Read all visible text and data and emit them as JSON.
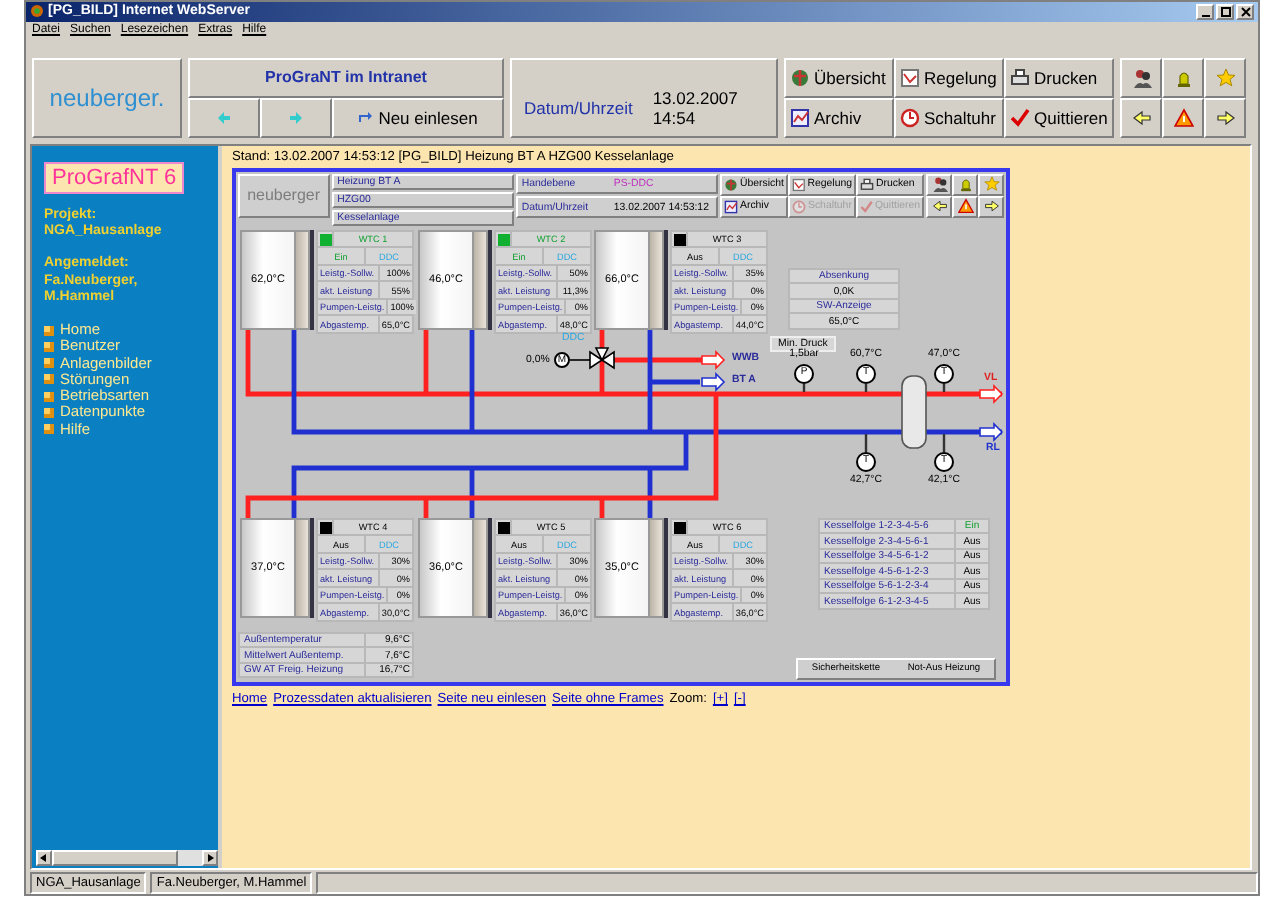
{
  "window": {
    "title": "[PG_BILD] Internet WebServer"
  },
  "menu": [
    "Datei",
    "Suchen",
    "Lesezeichen",
    "Extras",
    "Hilfe"
  ],
  "toolbar": {
    "logo": "neuberger.",
    "app_title": "ProGraNT im Intranet",
    "reload": "Neu einlesen",
    "datetime_label": "Datum/Uhrzeit",
    "datetime": "13.02.2007 14:54",
    "buttons": [
      {
        "label": "Übersicht",
        "kind": "overview"
      },
      {
        "label": "Regelung",
        "kind": "control"
      },
      {
        "label": "Drucken",
        "kind": "print"
      },
      {
        "label": "Archiv",
        "kind": "archive"
      },
      {
        "label": "Schaltuhr",
        "kind": "clock"
      },
      {
        "label": "Quittieren",
        "kind": "ack"
      }
    ]
  },
  "sidebar": {
    "logo": "ProGrafNT 6",
    "project_label": "Projekt:",
    "project": "NGA_Hausanlage",
    "user_label": "Angemeldet:",
    "user": [
      "Fa.Neuberger,",
      "M.Hammel"
    ],
    "items": [
      "Home",
      "Benutzer",
      "Anlagenbilder",
      "Störungen",
      "Betriebsarten",
      "Datenpunkte",
      "Hilfe"
    ]
  },
  "content": {
    "stand": "Stand: 13.02.2007 14:53:12 [PG_BILD] Heizung BT A HZG00 Kesselanlage",
    "header": {
      "logo": "neuberger",
      "info": [
        "Heizung BT A",
        "HZG00",
        "Kesselanlage"
      ],
      "mode_label": "Handebene",
      "mode": "PS-DDC",
      "datetime_label": "Datum/Uhrzeit",
      "datetime": "13.02.2007 14:53:12",
      "buttons": [
        {
          "label": "Übersicht",
          "kind": "overview",
          "disabled": false
        },
        {
          "label": "Regelung",
          "kind": "control",
          "disabled": false
        },
        {
          "label": "Drucken",
          "kind": "print",
          "disabled": false
        },
        {
          "label": "Archiv",
          "kind": "archive",
          "disabled": false
        },
        {
          "label": "Schaltuhr",
          "kind": "clock",
          "disabled": true
        },
        {
          "label": "Quittieren",
          "kind": "ack",
          "disabled": true
        }
      ]
    },
    "boilers": [
      {
        "name": "WTC 1",
        "temp": "62,0°C",
        "on": true,
        "state": "Ein",
        "control": "DDC",
        "rows": [
          {
            "label": "Leistg.-Sollw.",
            "value": "100%"
          },
          {
            "label": "akt. Leistung",
            "value": "55%"
          },
          {
            "label": "Pumpen-Leistg.",
            "value": "100%"
          },
          {
            "label": "Abgastemp.",
            "value": "65,0°C"
          }
        ]
      },
      {
        "name": "WTC 2",
        "temp": "46,0°C",
        "on": true,
        "state": "Ein",
        "control": "DDC",
        "rows": [
          {
            "label": "Leistg.-Sollw.",
            "value": "50%"
          },
          {
            "label": "akt. Leistung",
            "value": "11,3%"
          },
          {
            "label": "Pumpen-Leistg.",
            "value": "0%"
          },
          {
            "label": "Abgastemp.",
            "value": "48,0°C"
          }
        ]
      },
      {
        "name": "WTC 3",
        "temp": "66,0°C",
        "on": false,
        "state": "Aus",
        "control": "DDC",
        "rows": [
          {
            "label": "Leistg.-Sollw.",
            "value": "35%"
          },
          {
            "label": "akt. Leistung",
            "value": "0%"
          },
          {
            "label": "Pumpen-Leistg.",
            "value": "0%"
          },
          {
            "label": "Abgastemp.",
            "value": "44,0°C"
          }
        ]
      },
      {
        "name": "WTC 4",
        "temp": "37,0°C",
        "on": false,
        "state": "Aus",
        "control": "DDC",
        "rows": [
          {
            "label": "Leistg.-Sollw.",
            "value": "30%"
          },
          {
            "label": "akt. Leistung",
            "value": "0%"
          },
          {
            "label": "Pumpen-Leistg.",
            "value": "0%"
          },
          {
            "label": "Abgastemp.",
            "value": "30,0°C"
          }
        ]
      },
      {
        "name": "WTC 5",
        "temp": "36,0°C",
        "on": false,
        "state": "Aus",
        "control": "DDC",
        "rows": [
          {
            "label": "Leistg.-Sollw.",
            "value": "30%"
          },
          {
            "label": "akt. Leistung",
            "value": "0%"
          },
          {
            "label": "Pumpen-Leistg.",
            "value": "0%"
          },
          {
            "label": "Abgastemp.",
            "value": "36,0°C"
          }
        ]
      },
      {
        "name": "WTC 6",
        "temp": "35,0°C",
        "on": false,
        "state": "Aus",
        "control": "DDC",
        "rows": [
          {
            "label": "Leistg.-Sollw.",
            "value": "30%"
          },
          {
            "label": "akt. Leistung",
            "value": "0%"
          },
          {
            "label": "Pumpen-Leistg.",
            "value": "0%"
          },
          {
            "label": "Abgastemp.",
            "value": "36,0°C"
          }
        ]
      }
    ],
    "mixer": {
      "control": "DDC",
      "opening": "0,0%",
      "motor": "M"
    },
    "outputs": [
      "WWB",
      "BT A"
    ],
    "setback": [
      "Absenkung",
      "0,0K",
      "SW-Anzeige",
      "65,0°C"
    ],
    "min_pressure_label": "Min. Druck",
    "gauges": [
      {
        "symbol": "P",
        "reading": "1,5bar"
      },
      {
        "symbol": "T",
        "reading": "60,7°C"
      },
      {
        "symbol": "T",
        "reading": "47,0°C"
      },
      {
        "symbol": "T",
        "reading": "42,7°C"
      },
      {
        "symbol": "T",
        "reading": "42,1°C"
      }
    ],
    "flow_label": "VL",
    "return_label": "RL",
    "sequence": [
      {
        "label": "Kesselfolge 1-2-3-4-5-6",
        "state": "Ein",
        "active": true
      },
      {
        "label": "Kesselfolge 2-3-4-5-6-1",
        "state": "Aus",
        "active": false
      },
      {
        "label": "Kesselfolge 3-4-5-6-1-2",
        "state": "Aus",
        "active": false
      },
      {
        "label": "Kesselfolge 4-5-6-1-2-3",
        "state": "Aus",
        "active": false
      },
      {
        "label": "Kesselfolge 5-6-1-2-3-4",
        "state": "Aus",
        "active": false
      },
      {
        "label": "Kesselfolge 6-1-2-3-4-5",
        "state": "Aus",
        "active": false
      }
    ],
    "outdoor": [
      {
        "label": "Außentemperatur",
        "value": "9,6°C"
      },
      {
        "label": "Mittelwert Außentemp.",
        "value": "7,6°C"
      },
      {
        "label": "GW AT Freig. Heizung",
        "value": "16,7°C"
      }
    ],
    "safety": [
      "Sicherheitskette",
      "Not-Aus Heizung"
    ],
    "links": [
      "Home",
      "Prozessdaten aktualisieren",
      "Seite neu einlesen",
      "Seite ohne Frames"
    ],
    "zoom_label": "Zoom:",
    "zoom": [
      "[+]",
      "[-]"
    ]
  },
  "status_bar": [
    "NGA_Hausanlage",
    "Fa.Neuberger, M.Hammel"
  ]
}
